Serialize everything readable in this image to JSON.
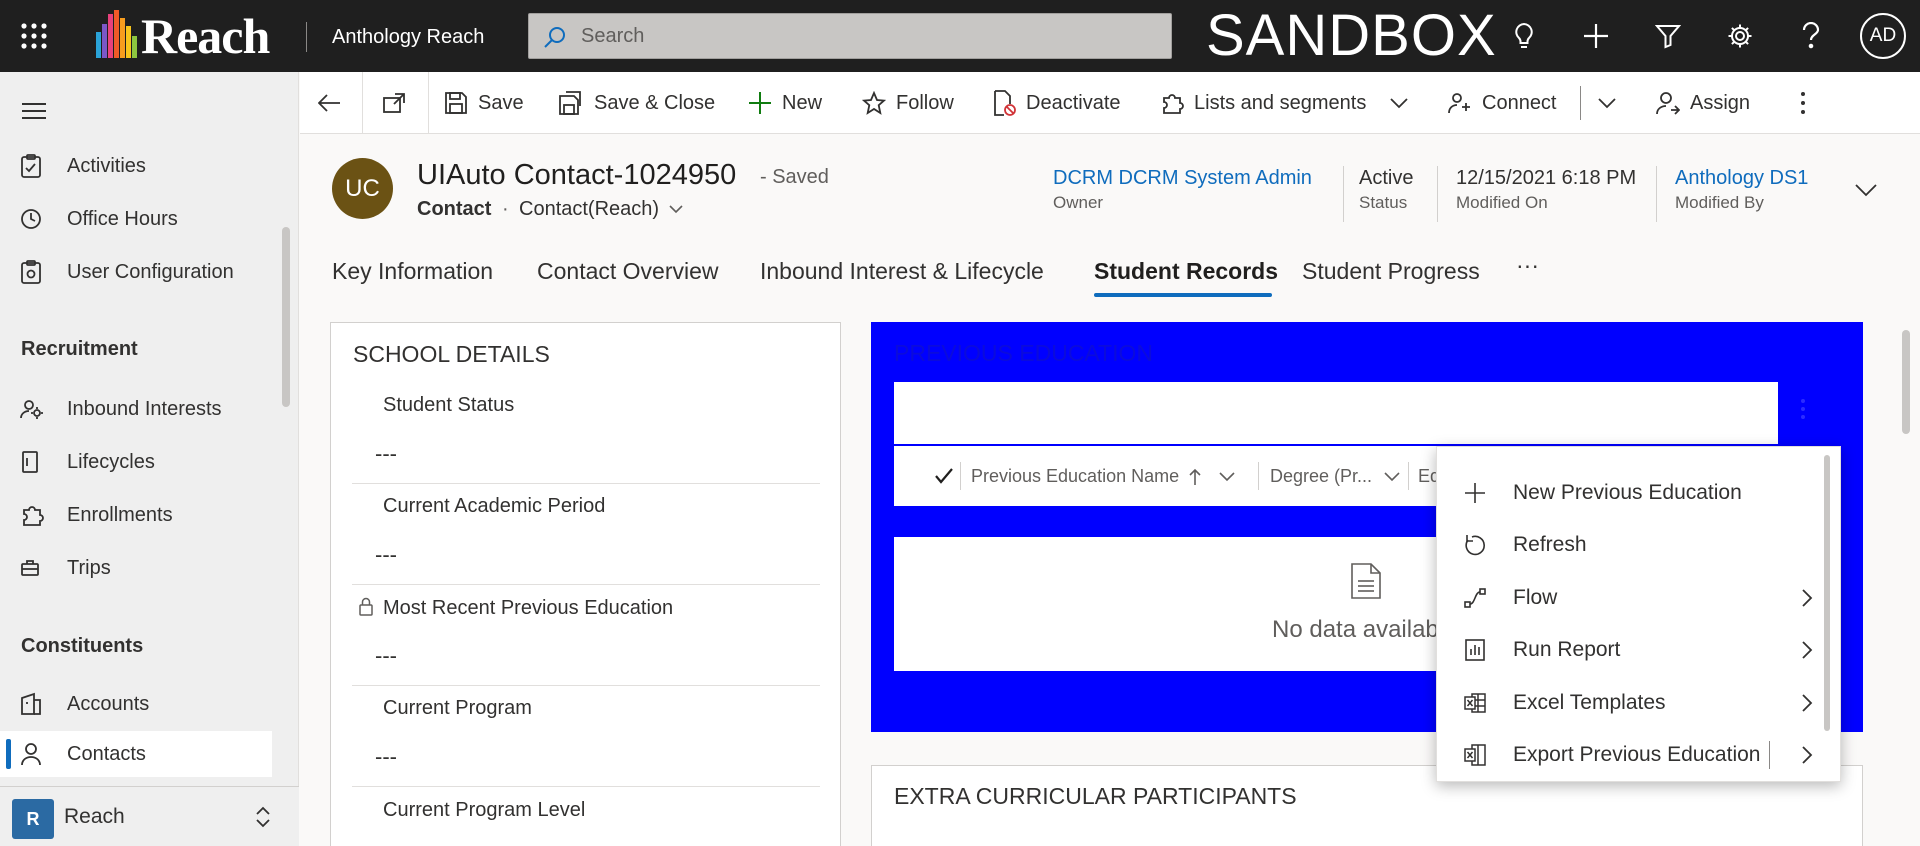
{
  "app": {
    "brand": "Reach",
    "name": "Anthology Reach",
    "environment": "SANDBOX",
    "user_initials": "AD",
    "search_placeholder": "Search"
  },
  "sidebar": {
    "items_top": [
      {
        "label": "Activities",
        "icon": "clipboard-icon"
      },
      {
        "label": "Office Hours",
        "icon": "clock-icon"
      },
      {
        "label": "User Configuration",
        "icon": "clipboard-gear-icon"
      }
    ],
    "groups": [
      {
        "title": "Recruitment",
        "items": [
          {
            "label": "Inbound Interests",
            "icon": "people-gear-icon"
          },
          {
            "label": "Lifecycles",
            "icon": "document-icon"
          },
          {
            "label": "Enrollments",
            "icon": "puzzle-icon"
          },
          {
            "label": "Trips",
            "icon": "suitcase-icon"
          }
        ]
      },
      {
        "title": "Constituents",
        "items": [
          {
            "label": "Accounts",
            "icon": "building-icon"
          },
          {
            "label": "Contacts",
            "icon": "person-icon",
            "active": true
          }
        ]
      }
    ],
    "area": {
      "badge": "R",
      "name": "Reach"
    }
  },
  "commandbar": {
    "save": "Save",
    "save_close": "Save & Close",
    "new": "New",
    "follow": "Follow",
    "deactivate": "Deactivate",
    "lists": "Lists and segments",
    "connect": "Connect",
    "assign": "Assign"
  },
  "record": {
    "initials": "UC",
    "title": "UIAuto Contact-1024950",
    "saved": "- Saved",
    "entity": "Contact",
    "dot": "·",
    "form": "Contact(Reach)",
    "owner": {
      "value": "DCRM DCRM System Admin",
      "label": "Owner"
    },
    "status": {
      "value": "Active",
      "label": "Status"
    },
    "modified_on": {
      "value": "12/15/2021 6:18 PM",
      "label": "Modified On"
    },
    "modified_by": {
      "value": "Anthology DS1",
      "label": "Modified By"
    }
  },
  "tabs": [
    {
      "label": "Key Information"
    },
    {
      "label": "Contact Overview"
    },
    {
      "label": "Inbound Interest & Lifecycle"
    },
    {
      "label": "Student Records",
      "active": true
    },
    {
      "label": "Student Progress"
    },
    {
      "label": "···"
    }
  ],
  "school_details": {
    "title": "SCHOOL DETAILS",
    "fields": [
      {
        "label": "Student Status",
        "value": "---",
        "locked": false
      },
      {
        "label": "Current Academic Period",
        "value": "---",
        "locked": false
      },
      {
        "label": "Most Recent Previous Education",
        "value": "---",
        "locked": true
      },
      {
        "label": "Current Program",
        "value": "---",
        "locked": false
      },
      {
        "label": "Current Program Level",
        "value": "",
        "locked": false
      }
    ]
  },
  "previous_education": {
    "title": "PREVIOUS EDUCATION",
    "columns": [
      "Previous Education Name",
      "Degree (Pr...",
      "Ed"
    ],
    "empty_text": "No data available",
    "accent": "#0000ff"
  },
  "extra_curricular": {
    "title": "EXTRA CURRICULAR PARTICIPANTS"
  },
  "context_menu": {
    "items": [
      {
        "label": "New Previous Education",
        "icon": "plus-icon",
        "submenu": false
      },
      {
        "label": "Refresh",
        "icon": "refresh-icon",
        "submenu": false
      },
      {
        "label": "Flow",
        "icon": "flow-icon",
        "submenu": true
      },
      {
        "label": "Run Report",
        "icon": "report-icon",
        "submenu": true
      },
      {
        "label": "Excel Templates",
        "icon": "excel-icon",
        "submenu": true
      },
      {
        "label": "Export Previous Education",
        "icon": "excel-export-icon",
        "submenu": true
      }
    ]
  }
}
